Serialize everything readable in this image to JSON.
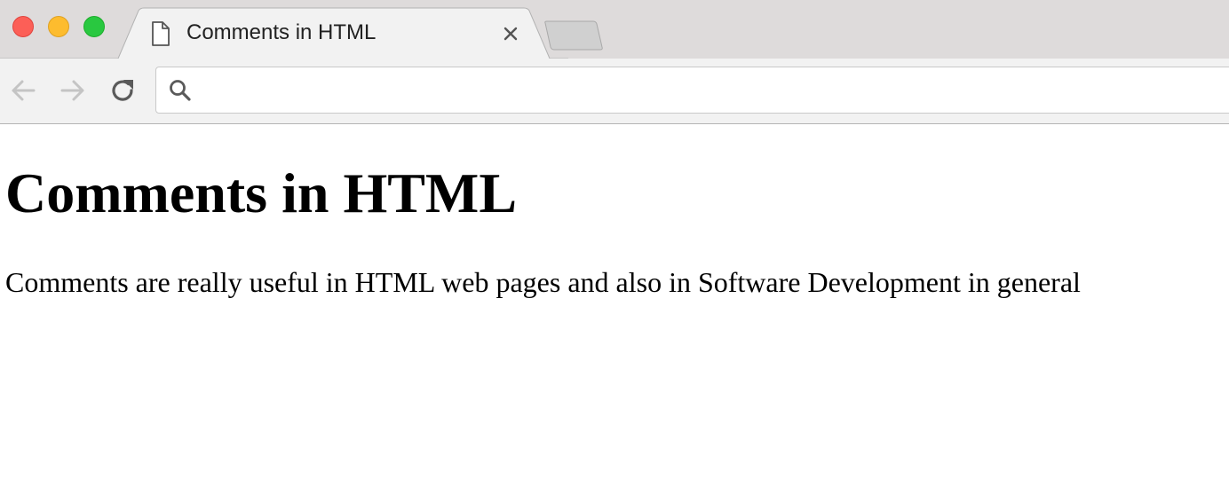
{
  "window": {
    "controls": {
      "close": "close",
      "minimize": "minimize",
      "zoom": "zoom"
    }
  },
  "tabs": [
    {
      "title": "Comments in HTML",
      "favicon": "document-icon",
      "active": true
    }
  ],
  "toolbar": {
    "back_icon": "arrow-left-icon",
    "forward_icon": "arrow-right-icon",
    "reload_icon": "reload-icon",
    "omnibox": {
      "value": "",
      "placeholder": "",
      "icon": "search-icon"
    }
  },
  "page": {
    "heading": "Comments in HTML",
    "paragraph": "Comments are really useful in HTML web pages and also in Software Development in general"
  },
  "colors": {
    "tabstrip_bg": "#dedbdb",
    "active_tab_bg": "#f2f2f2",
    "toolbar_bg": "#f2f2f2",
    "traffic_close": "#fc5f57",
    "traffic_minimize": "#fdbc2e",
    "traffic_zoom": "#29c840",
    "disabled_icon": "#c4c4c4",
    "enabled_icon": "#5a5a5a"
  }
}
